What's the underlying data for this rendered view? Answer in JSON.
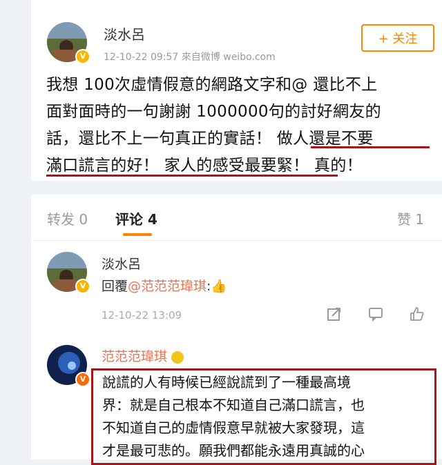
{
  "post": {
    "author": "淡水呂",
    "meta": "12-10-22 09:57  來自微博 weibo.com",
    "follow_label": "+ 关注",
    "lines": [
      "我想 100次虛情假意的網路文字和@ 還比不上",
      "面對面時的一句謝謝 1000000句的討好網友的",
      "話，還比不上一句真正的實話！ 做人還是不要",
      "滿口謊言的好！ 家人的感受最要緊！ 真的！"
    ]
  },
  "comments_header": {
    "forward_label": "转发 0",
    "comment_label": "评论 4",
    "like_label": "赞 1"
  },
  "comment1": {
    "author": "淡水呂",
    "reply_prefix": "回覆",
    "mention": "@范范范瑋琪",
    "emoji": ":👍",
    "time": "12-10-22 13:09"
  },
  "comment2": {
    "author": "范范范瑋琪",
    "lines": [
      "說謊的人有時候已經說謊到了一種最高境",
      "界：就是自己根本不知道自己滿口謊言，也",
      "不知道自己的虛情假意早就被大家發現，這",
      "才是最可悲的。願我們都能永遠用真誠的心"
    ]
  },
  "colors": {
    "accent": "#ff8200",
    "highlight_border": "#a8141c",
    "mention": "#eb7350"
  }
}
